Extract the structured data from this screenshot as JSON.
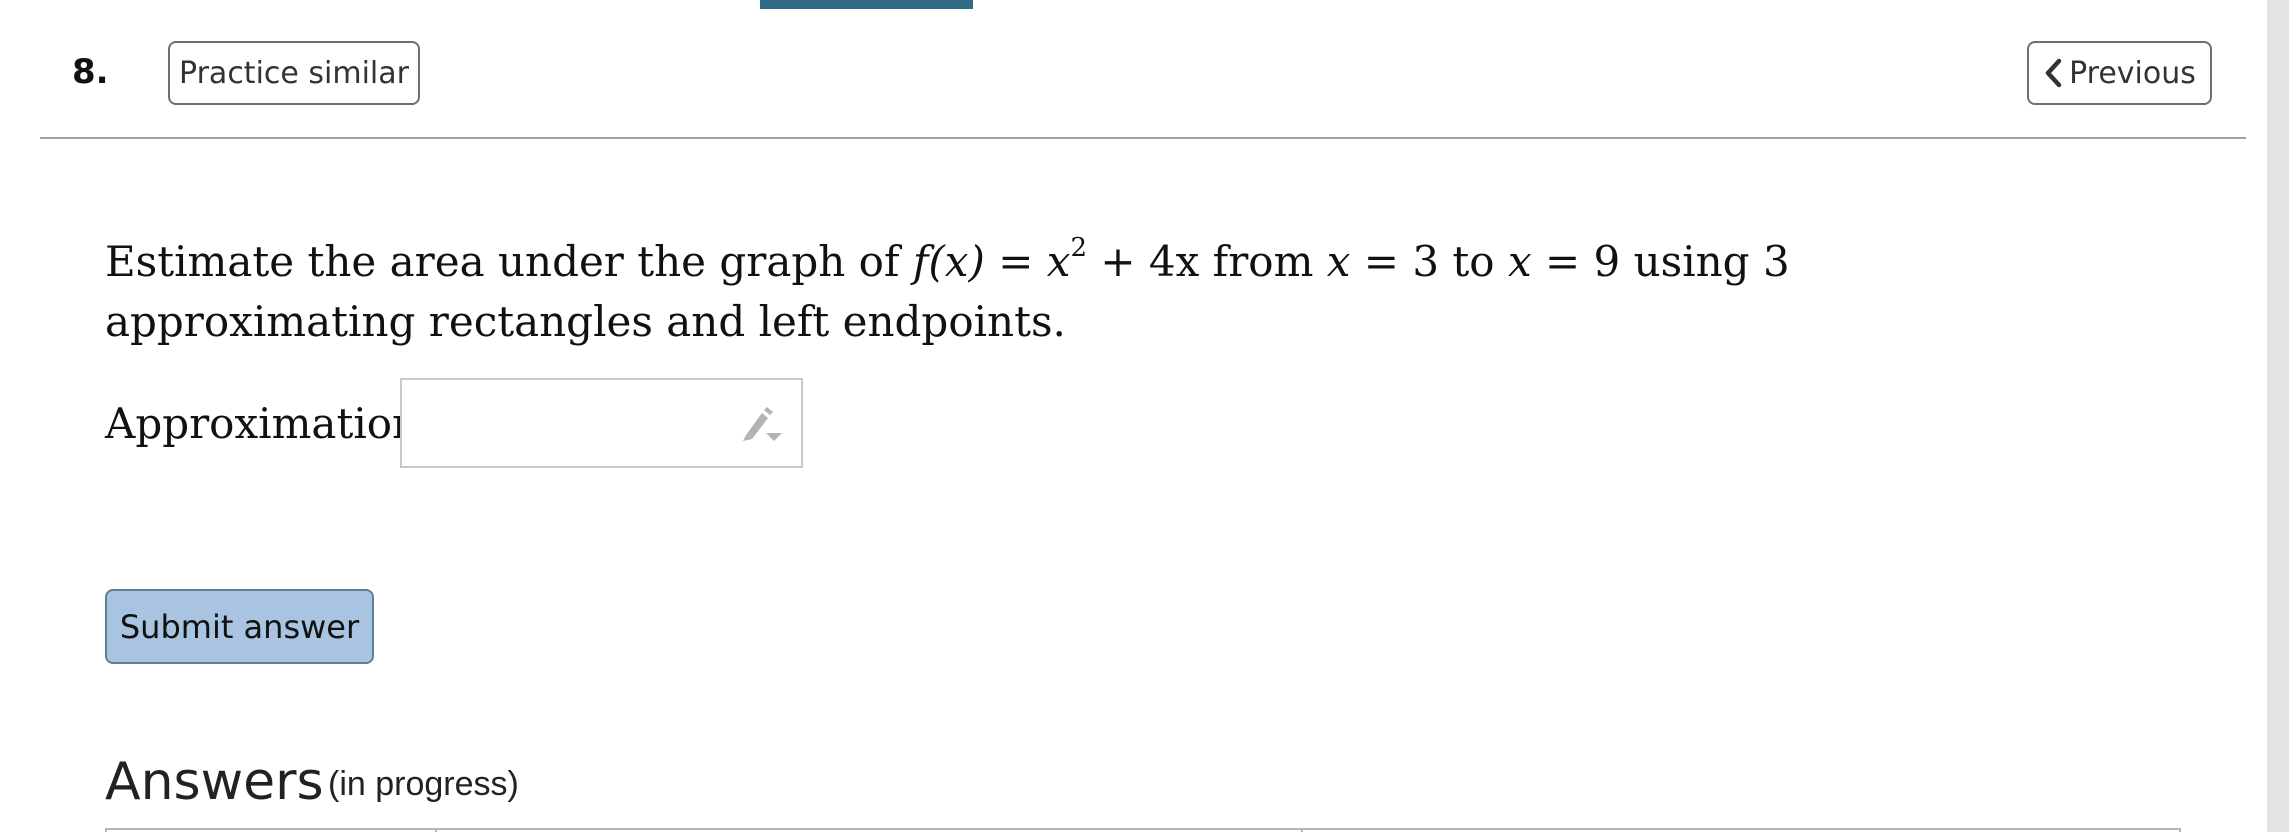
{
  "header": {
    "question_number": "8.",
    "practice_button_label": "Practice similar",
    "previous_button_label": "Previous"
  },
  "problem": {
    "statement_pre": "Estimate the area under the graph of ",
    "function_lhs": "f(x)",
    "function_rhs_base": "x",
    "function_rhs_exp": "2",
    "function_rhs_rest": " + 4x",
    "from_text": " from ",
    "x_var_1": "x",
    "eq_1": " = 3",
    "to_text": " to ",
    "x_var_2": "x",
    "eq_2": " = 9",
    "using_text": " using ",
    "rect_count": "3",
    "statement_post": " approximating rectangles and left endpoints.",
    "answer_label": "Approximation =",
    "answer_value": ""
  },
  "actions": {
    "submit_label": "Submit answer"
  },
  "answers": {
    "title": "Answers",
    "status": "(in progress)"
  },
  "colors": {
    "accent": "#2e6b86",
    "submit_bg": "#a8c4e0"
  },
  "icons": {
    "previous": "chevron-left-icon",
    "input_tool": "pencil-icon"
  }
}
